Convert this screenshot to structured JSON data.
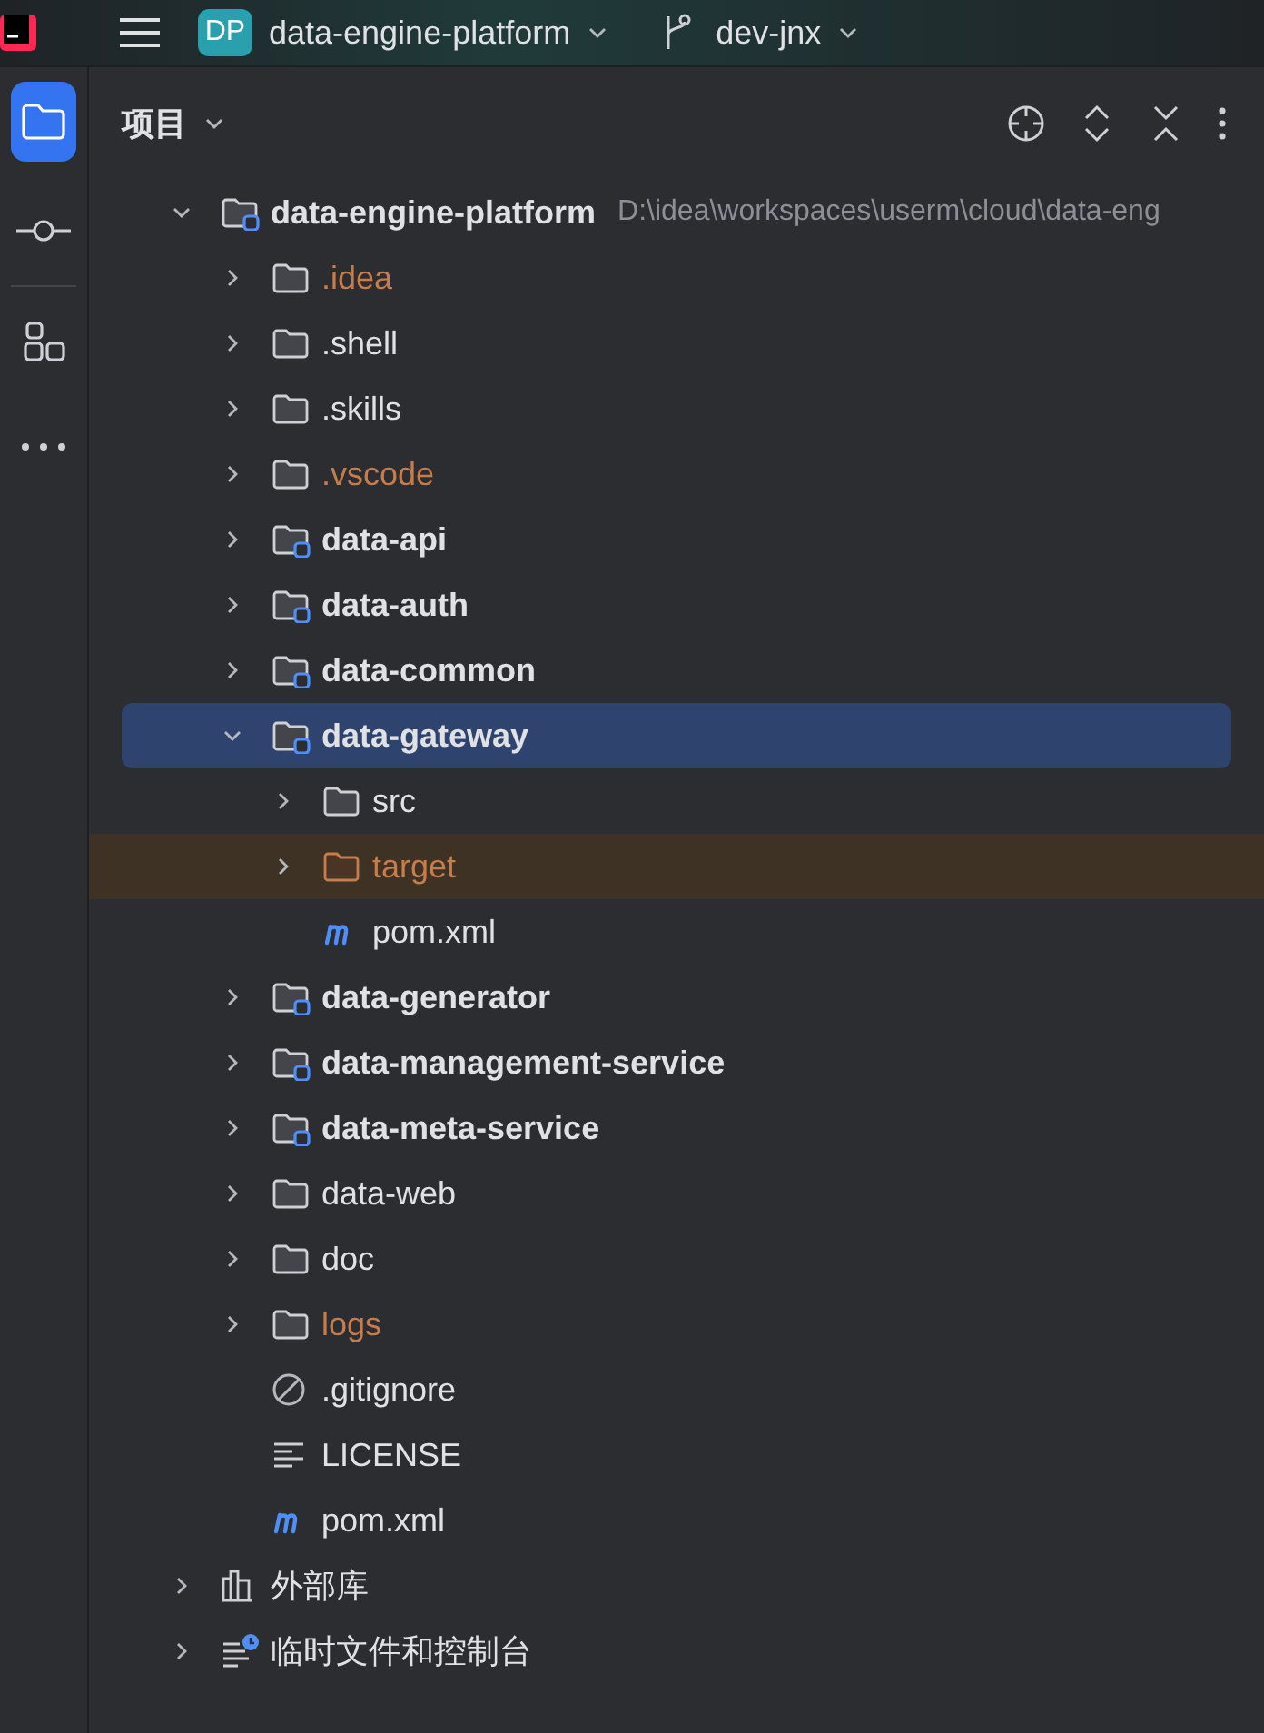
{
  "titlebar": {
    "project_badge": "DP",
    "project_name": "data-engine-platform",
    "branch": "dev-jnx"
  },
  "side_tools": [
    {
      "kind": "project",
      "selected": true
    },
    {
      "kind": "commit",
      "selected": false
    },
    {
      "kind": "structure",
      "selected": false
    },
    {
      "kind": "more",
      "selected": false
    }
  ],
  "panel": {
    "title": "项目"
  },
  "tree": [
    {
      "name": "data-engine-platform",
      "hint": "D:\\idea\\workspaces\\userm\\cloud\\data-eng",
      "kind": "module",
      "expanded": true,
      "selected": false,
      "ignored": false,
      "excluded": false,
      "children": [
        {
          "name": ".idea",
          "kind": "folder",
          "expanded": false,
          "selected": false,
          "ignored": true,
          "excluded": false
        },
        {
          "name": ".shell",
          "kind": "folder",
          "expanded": false,
          "selected": false,
          "ignored": false,
          "excluded": false
        },
        {
          "name": ".skills",
          "kind": "folder",
          "expanded": false,
          "selected": false,
          "ignored": false,
          "excluded": false
        },
        {
          "name": ".vscode",
          "kind": "folder",
          "expanded": false,
          "selected": false,
          "ignored": true,
          "excluded": false
        },
        {
          "name": "data-api",
          "kind": "module",
          "expanded": false,
          "selected": false,
          "ignored": false,
          "excluded": false
        },
        {
          "name": "data-auth",
          "kind": "module",
          "expanded": false,
          "selected": false,
          "ignored": false,
          "excluded": false
        },
        {
          "name": "data-common",
          "kind": "module",
          "expanded": false,
          "selected": false,
          "ignored": false,
          "excluded": false
        },
        {
          "name": "data-gateway",
          "kind": "module",
          "expanded": true,
          "selected": true,
          "ignored": false,
          "excluded": false,
          "children": [
            {
              "name": "src",
              "kind": "folder",
              "expanded": false,
              "selected": false,
              "ignored": false,
              "excluded": false
            },
            {
              "name": "target",
              "kind": "folder",
              "expanded": false,
              "selected": false,
              "ignored": true,
              "excluded": true
            },
            {
              "name": "pom.xml",
              "kind": "maven",
              "selected": false,
              "ignored": false,
              "excluded": false
            }
          ]
        },
        {
          "name": "data-generator",
          "kind": "module",
          "expanded": false,
          "selected": false,
          "ignored": false,
          "excluded": false
        },
        {
          "name": "data-management-service",
          "kind": "module",
          "expanded": false,
          "selected": false,
          "ignored": false,
          "excluded": false
        },
        {
          "name": "data-meta-service",
          "kind": "module",
          "expanded": false,
          "selected": false,
          "ignored": false,
          "excluded": false
        },
        {
          "name": "data-web",
          "kind": "folder",
          "expanded": false,
          "selected": false,
          "ignored": false,
          "excluded": false
        },
        {
          "name": "doc",
          "kind": "folder",
          "expanded": false,
          "selected": false,
          "ignored": false,
          "excluded": false
        },
        {
          "name": "logs",
          "kind": "folder",
          "expanded": false,
          "selected": false,
          "ignored": true,
          "excluded": false
        },
        {
          "name": ".gitignore",
          "kind": "ignore",
          "selected": false,
          "ignored": false,
          "excluded": false
        },
        {
          "name": "LICENSE",
          "kind": "text",
          "selected": false,
          "ignored": false,
          "excluded": false
        },
        {
          "name": "pom.xml",
          "kind": "maven",
          "selected": false,
          "ignored": false,
          "excluded": false
        }
      ]
    },
    {
      "name": "外部库",
      "kind": "libraries",
      "expanded": false,
      "selected": false,
      "ignored": false,
      "excluded": false
    },
    {
      "name": "临时文件和控制台",
      "kind": "scratches",
      "expanded": false,
      "selected": false,
      "ignored": false,
      "excluded": false
    }
  ]
}
